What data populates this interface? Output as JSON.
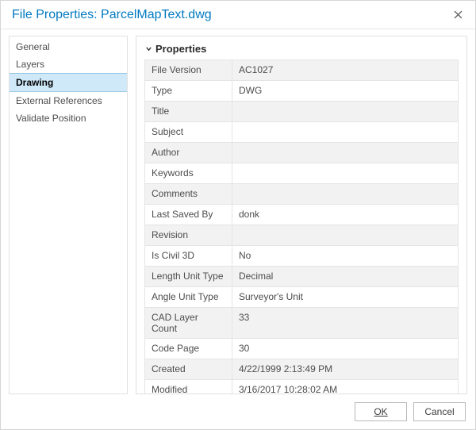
{
  "dialog": {
    "title": "File Properties: ParcelMapText.dwg"
  },
  "sidebar": {
    "items": [
      {
        "label": "General"
      },
      {
        "label": "Layers"
      },
      {
        "label": "Drawing"
      },
      {
        "label": "External References"
      },
      {
        "label": "Validate Position"
      }
    ],
    "selected_index": 2
  },
  "section": {
    "title": "Properties"
  },
  "properties": [
    {
      "label": "File Version",
      "value": "AC1027"
    },
    {
      "label": "Type",
      "value": "DWG"
    },
    {
      "label": "Title",
      "value": ""
    },
    {
      "label": "Subject",
      "value": ""
    },
    {
      "label": "Author",
      "value": ""
    },
    {
      "label": "Keywords",
      "value": ""
    },
    {
      "label": "Comments",
      "value": ""
    },
    {
      "label": "Last Saved By",
      "value": "donk"
    },
    {
      "label": "Revision",
      "value": ""
    },
    {
      "label": "Is Civil 3D",
      "value": "No"
    },
    {
      "label": "Length Unit Type",
      "value": "Decimal"
    },
    {
      "label": "Angle Unit Type",
      "value": "Surveyor's Unit"
    },
    {
      "label": "CAD Layer Count",
      "value": "33"
    },
    {
      "label": "Code Page",
      "value": "30"
    },
    {
      "label": "Created",
      "value": "4/22/1999 2:13:49 PM"
    },
    {
      "label": "Modified",
      "value": "3/16/2017 10:28:02 AM"
    }
  ],
  "footer": {
    "ok": "OK",
    "cancel": "Cancel"
  }
}
